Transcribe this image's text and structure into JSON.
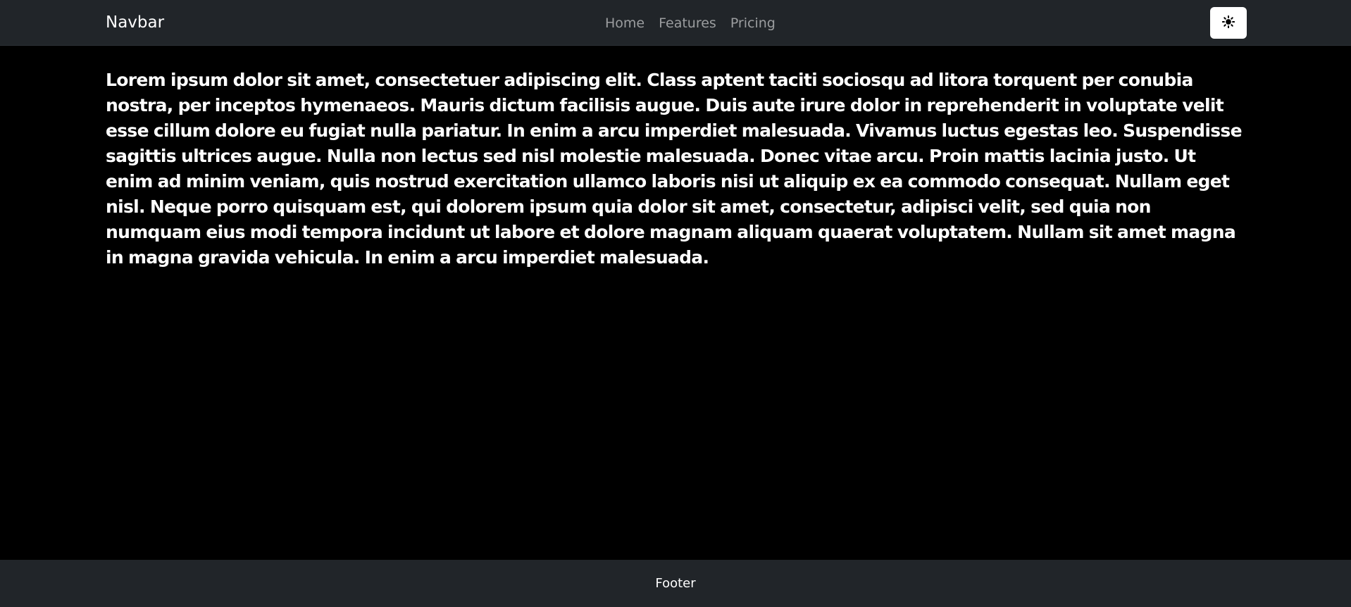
{
  "navbar": {
    "brand": "Navbar",
    "links": [
      {
        "label": "Home"
      },
      {
        "label": "Features"
      },
      {
        "label": "Pricing"
      }
    ],
    "theme_toggle_icon": "sun-icon"
  },
  "main": {
    "paragraph": "Lorem ipsum dolor sit amet, consectetuer adipiscing elit. Class aptent taciti sociosqu ad litora torquent per conubia nostra, per inceptos hymenaeos. Mauris dictum facilisis augue. Duis aute irure dolor in reprehenderit in voluptate velit esse cillum dolore eu fugiat nulla pariatur. In enim a arcu imperdiet malesuada. Vivamus luctus egestas leo. Suspendisse sagittis ultrices augue. Nulla non lectus sed nisl molestie malesuada. Donec vitae arcu. Proin mattis lacinia justo. Ut enim ad minim veniam, quis nostrud exercitation ullamco laboris nisi ut aliquip ex ea commodo consequat. Nullam eget nisl. Neque porro quisquam est, qui dolorem ipsum quia dolor sit amet, consectetur, adipisci velit, sed quia non numquam eius modi tempora incidunt ut labore et dolore magnam aliquam quaerat voluptatem. Nullam sit amet magna in magna gravida vehicula. In enim a arcu imperdiet malesuada."
  },
  "footer": {
    "text": "Footer"
  },
  "colors": {
    "navbar_bg": "#212529",
    "page_bg": "#000000",
    "text": "#ffffff",
    "nav_link": "rgba(255,255,255,0.55)",
    "toggle_bg": "#ffffff"
  }
}
